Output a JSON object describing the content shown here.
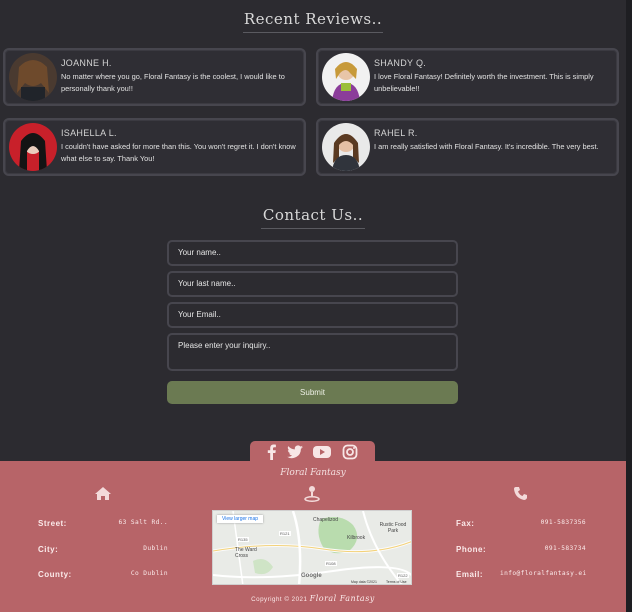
{
  "reviews_section": {
    "title": "Recent Reviews..",
    "reviews": [
      {
        "name": "JOANNE H.",
        "text": "No matter where you go, Floral Fantasy is the coolest, I would like to personally thank you!!"
      },
      {
        "name": "SHANDY Q.",
        "text": "I love Floral Fantasy! Definitely worth the investment. This is simply unbelievable!!"
      },
      {
        "name": "ISAHELLA L.",
        "text": "I couldn't have asked for more than this. You won't regret it. I don't know what else to say. Thank You!"
      },
      {
        "name": "RAHEL R.",
        "text": "I am really satisfied with Floral Fantasy. It's incredible. The very best."
      }
    ]
  },
  "contact_section": {
    "title": "Contact Us..",
    "name_placeholder": "Your name..",
    "last_name_placeholder": "Your last name..",
    "email_placeholder": "Your Email..",
    "inquiry_placeholder": "Please enter your inquiry..",
    "submit_label": "Submit"
  },
  "social": {
    "icons": [
      "facebook-icon",
      "twitter-icon",
      "youtube-icon",
      "instagram-icon"
    ]
  },
  "footer": {
    "brand": "Floral Fantasy",
    "icons": [
      "home-icon",
      "location-icon",
      "phone-icon"
    ],
    "left": [
      {
        "label": "Street:",
        "value": "63 Salt Rd.."
      },
      {
        "label": "City:",
        "value": "Dublin"
      },
      {
        "label": "County:",
        "value": "Co Dublin"
      }
    ],
    "right": [
      {
        "label": "Fax:",
        "value": "091-5837356"
      },
      {
        "label": "Phone:",
        "value": "091-583734"
      },
      {
        "label": "Email:",
        "value": "info@floralfantasy.ei"
      }
    ],
    "map": {
      "link": "View larger map",
      "places": [
        "Chapelizod",
        "Kilbrook",
        "Rustic Food Park",
        "The Ward Cross"
      ],
      "roads": [
        "R121",
        "R135",
        "R108",
        "R122"
      ],
      "provider": "Google",
      "attribution": "Map data ©2021",
      "terms": "Terms of Use"
    },
    "copyright_prefix": "Copyright © 2021",
    "copyright_brand": "Floral Fantasy"
  },
  "colors": {
    "background": "#2c2b30",
    "footer": "#b76468",
    "submit": "#6b7a52"
  }
}
